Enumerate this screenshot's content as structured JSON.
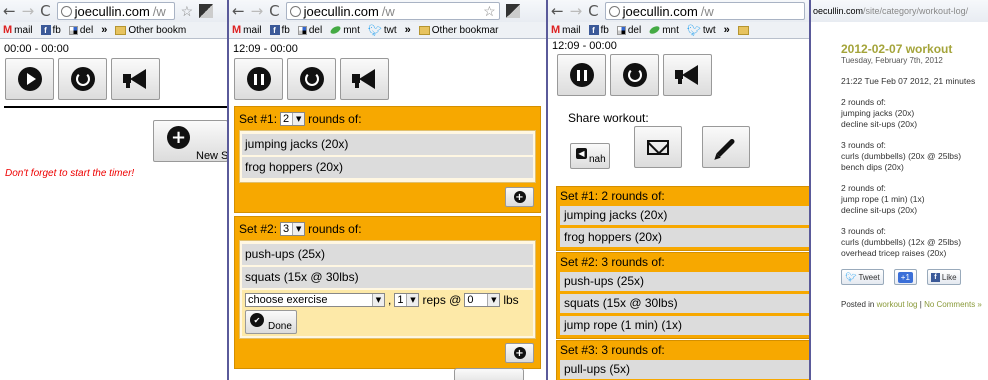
{
  "browser": {
    "url_host": "joecullin.com",
    "url_path": "/w",
    "bookmarks": [
      {
        "icon": "gmail-icon",
        "label": "mail"
      },
      {
        "icon": "facebook-icon",
        "label": "fb"
      },
      {
        "icon": "delicious-icon",
        "label": "del"
      },
      {
        "icon": "leaf-icon",
        "label": "mnt"
      },
      {
        "icon": "twitter-icon",
        "label": "twt"
      }
    ],
    "other_bookmarks": "Other bookm",
    "other_bookmarks_full": "Other bookmar",
    "chevron": "»"
  },
  "panel1": {
    "timer": "00:00 - 00:00",
    "new_set_label": "New S",
    "warning": "Don't forget to start the timer!"
  },
  "panel2": {
    "timer": "12:09 - 00:00",
    "sets": [
      {
        "head": "Set #1:",
        "rounds": "2",
        "rounds_suffix": "rounds of:",
        "items": [
          "jumping jacks (20x)",
          "frog hoppers (20x)"
        ]
      },
      {
        "head": "Set #2:",
        "rounds": "3",
        "rounds_suffix": "rounds of:",
        "items": [
          "push-ups (25x)",
          "squats (15x @ 30lbs)"
        ]
      }
    ],
    "form": {
      "exercise": "choose exercise",
      "reps": "1",
      "reps_label": "reps @",
      "weight": "0",
      "weight_label": "lbs",
      "comma": ",",
      "done_label": "Done"
    }
  },
  "panel3": {
    "timer": "12:09 - 00:00",
    "share_label": "Share workout:",
    "nah_label": "nah",
    "sets": [
      {
        "head": "Set #1: 2 rounds of:",
        "items": [
          "jumping jacks (20x)",
          "frog hoppers (20x)"
        ]
      },
      {
        "head": "Set #2: 3 rounds of:",
        "items": [
          "push-ups (25x)",
          "squats (15x @ 30lbs)",
          "jump rope (1 min) (1x)"
        ]
      },
      {
        "head": "Set #3: 3 rounds of:",
        "items": [
          "pull-ups (5x)"
        ]
      }
    ]
  },
  "panel4": {
    "url_host": "oecullin.com",
    "url_path": "/site/category/workout-log/",
    "title": "2012-02-07 workout",
    "date": "Tuesday, February 7th, 2012",
    "time_line": "21:22 Tue Feb 07 2012, 21 minutes",
    "blocks": [
      [
        "2 rounds of:",
        "jumping jacks (20x)",
        "decline sit-ups (20x)"
      ],
      [
        "3 rounds of:",
        "curls (dumbbells) (20x @ 25lbs)",
        "bench dips (20x)"
      ],
      [
        "2 rounds of:",
        "jump rope (1 min) (1x)",
        "decline sit-ups (20x)"
      ],
      [
        "3 rounds of:",
        "curls (dumbbells) (12x @ 25lbs)",
        "overhead tricep raises (20x)"
      ]
    ],
    "tweet": "Tweet",
    "gplus": "+1",
    "like": "Like",
    "posted_in": "Posted in",
    "category": "workout log",
    "sep": "|",
    "comments": "No Comments »"
  }
}
